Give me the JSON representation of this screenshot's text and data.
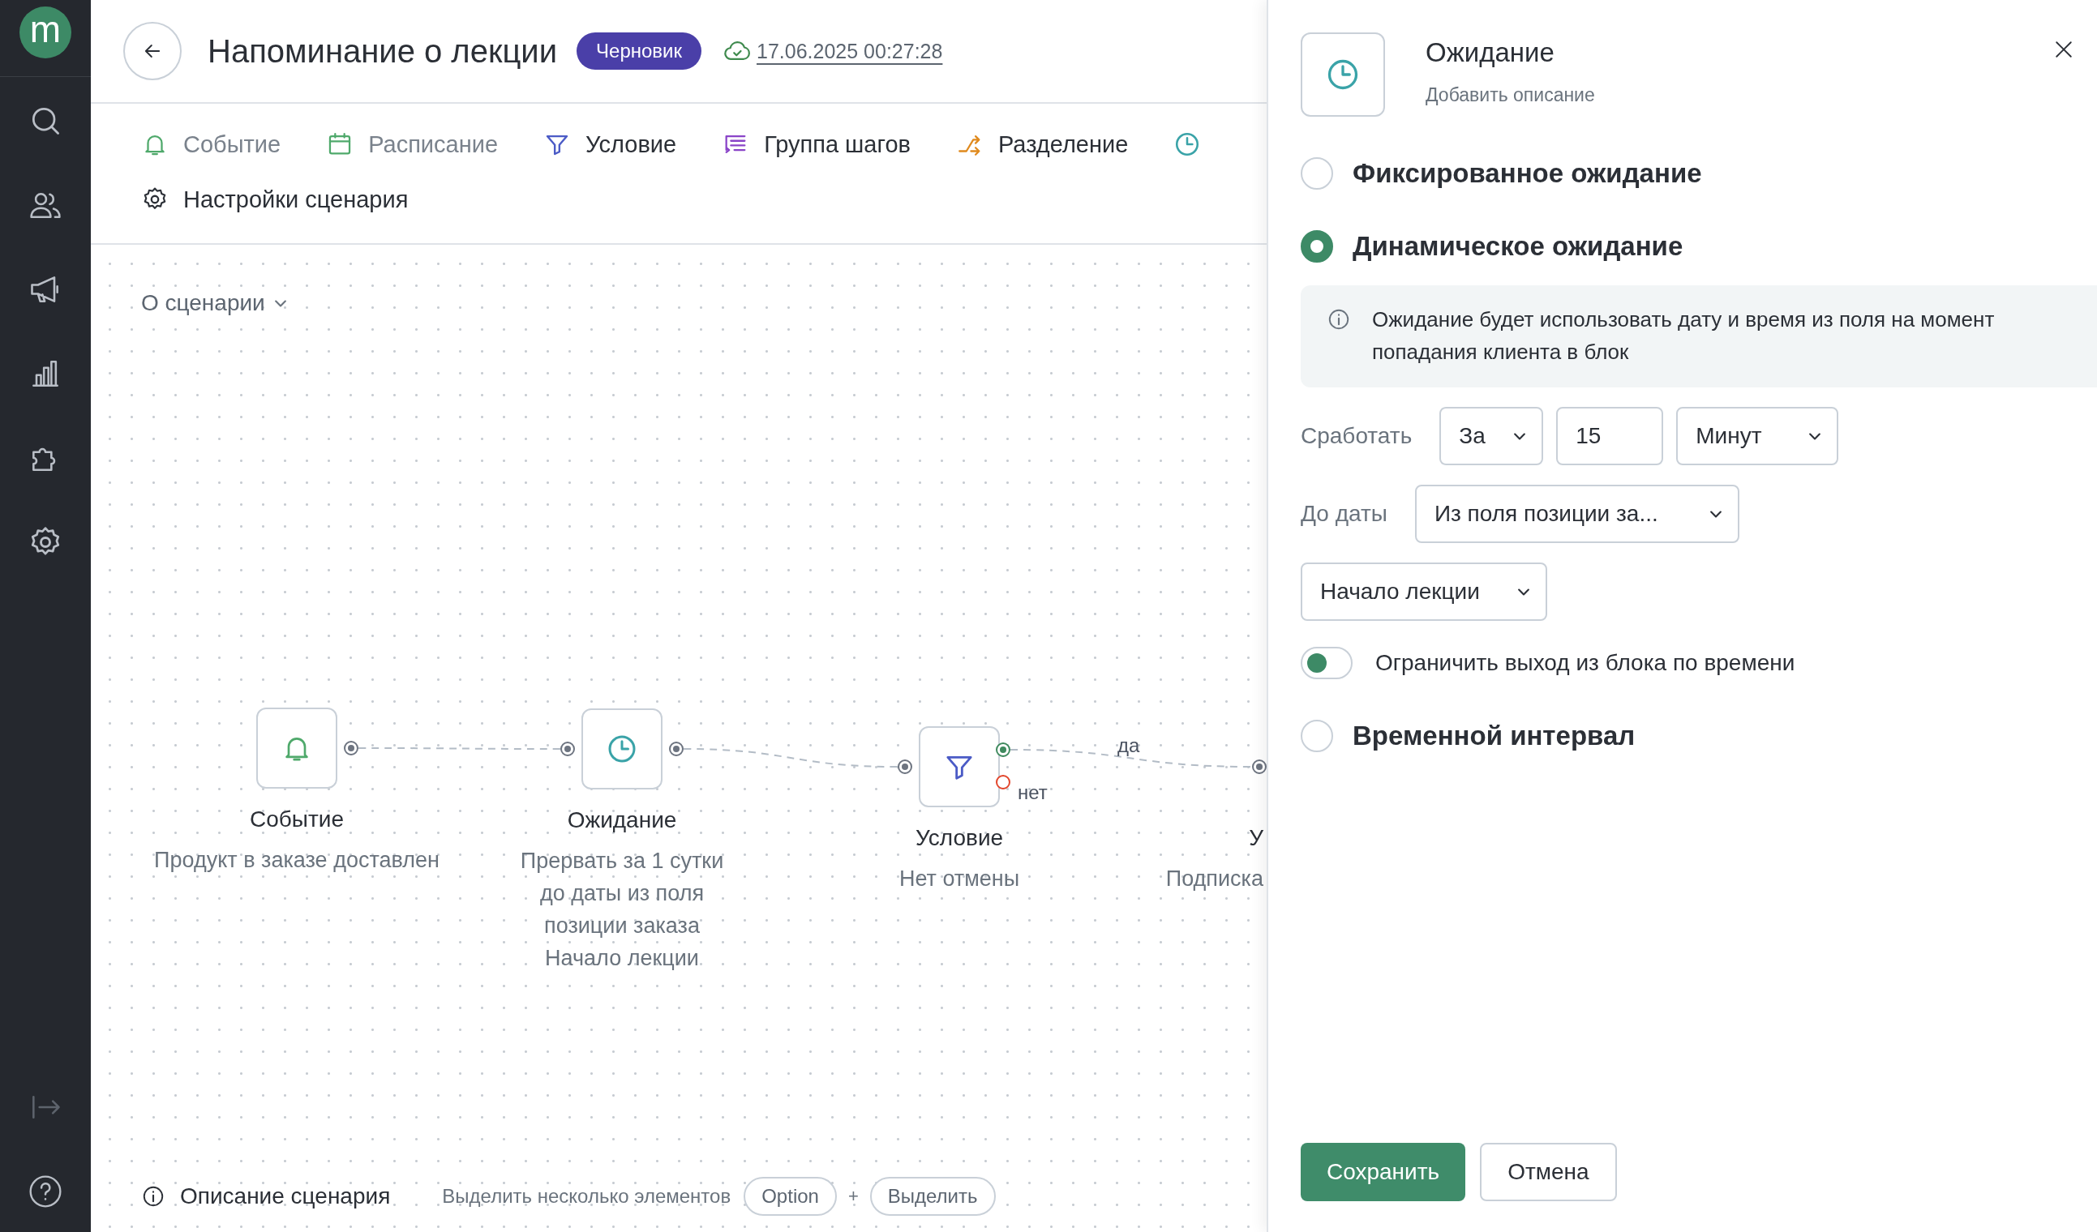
{
  "sidebar": {
    "logo": "m"
  },
  "header": {
    "title": "Напоминание о лекции",
    "status_badge": "Черновик",
    "saved_at": "17.06.2025 00:27:28"
  },
  "toolbar": {
    "items": [
      {
        "kind": "event",
        "label": "Событие",
        "disabled": true
      },
      {
        "kind": "schedule",
        "label": "Расписание",
        "disabled": true
      },
      {
        "kind": "condition",
        "label": "Условие",
        "disabled": false
      },
      {
        "kind": "group",
        "label": "Группа шагов",
        "disabled": false
      },
      {
        "kind": "split",
        "label": "Разделение",
        "disabled": false
      },
      {
        "kind": "settings",
        "label": "Настройки сценария",
        "disabled": false
      }
    ]
  },
  "canvas": {
    "about_dropdown": "О сценарии",
    "nodes": [
      {
        "kind": "event",
        "title": "Событие",
        "subtitle": "Продукт в заказе доставлен"
      },
      {
        "kind": "wait",
        "title": "Ожидание",
        "subtitle": "Прервать за 1 сутки до даты из поля позиции заказа Начало лекции"
      },
      {
        "kind": "condition",
        "title": "Условие",
        "subtitle": "Нет отмены",
        "yes_label": "да",
        "no_label": "нет"
      },
      {
        "kind": "cut",
        "title": "У",
        "subtitle": "Подписка"
      }
    ]
  },
  "footer": {
    "description_link": "Описание сценария",
    "hint": "Выделить несколько элементов",
    "keys": [
      "Option",
      "Выделить"
    ],
    "plus": "+"
  },
  "panel": {
    "title": "Ожидание",
    "description_placeholder": "Добавить описание",
    "options": [
      {
        "label": "Фиксированное ожидание",
        "selected": false
      },
      {
        "label": "Динамическое ожидание",
        "selected": true
      },
      {
        "label": "Временной интервал",
        "selected": false
      }
    ],
    "info": "Ожидание будет использовать дату и время из поля на момент попадания клиента в блок",
    "trigger": {
      "label": "Сработать",
      "direction": "За",
      "amount": "15",
      "unit": "Минут"
    },
    "until": {
      "label": "До даты",
      "source": "Из поля позиции за...",
      "field": "Начало лекции"
    },
    "limit_toggle": {
      "label": "Ограничить выход из блока по времени",
      "on": false
    },
    "buttons": {
      "save": "Сохранить",
      "cancel": "Отмена"
    }
  }
}
